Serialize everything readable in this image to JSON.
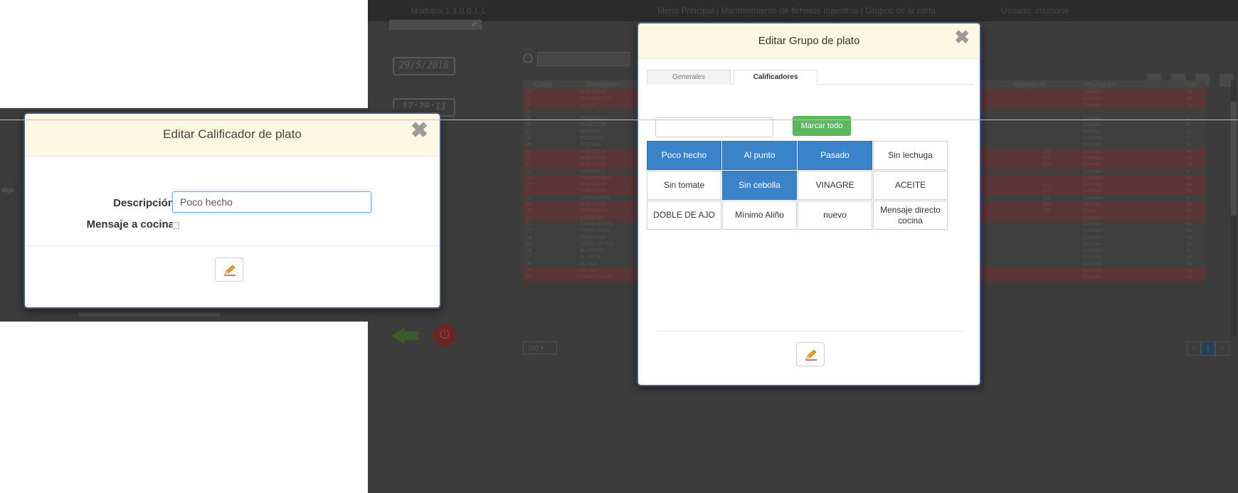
{
  "app": {
    "modulos": "Módulos 1.1.0.0.1.1",
    "menu_path": "Menú Principal  |  Mantenimiento de ficheros maestros  |  Grupos de la carta",
    "usuario": "Usuario: classone",
    "date": "29/5/2016",
    "time": "17:29:11",
    "grid_headers": {
      "codigo": "Código",
      "descripcion": "Descripción",
      "tipo_ingreso": "Tipo Ingreso",
      "macrogrupo": "Macrogrupo",
      "foto": "Foto"
    },
    "rows": [
      {
        "code": "01",
        "desc": "NUEVO189",
        "tipo": "",
        "macro": "Comidas",
        "foto": "No",
        "style": "red"
      },
      {
        "code": "02",
        "desc": "ALQUILERES",
        "tipo": "",
        "macro": "Comidas",
        "foto": "No",
        "style": "red"
      },
      {
        "code": "03",
        "desc": "VINOS",
        "tipo": "",
        "macro": "Comidas",
        "foto": "No",
        "style": "red"
      },
      {
        "code": "04",
        "desc": "",
        "tipo": "",
        "macro": "",
        "foto": "",
        "style": "dark"
      },
      {
        "code": "05",
        "desc": "PESCADOS",
        "tipo": "",
        "macro": "Comidas",
        "foto": "Sí",
        "style": "dark"
      },
      {
        "code": "06",
        "desc": "MARISCOS",
        "tipo": "",
        "macro": "Comidas",
        "foto": "Sí",
        "style": "dark"
      },
      {
        "code": "07",
        "desc": "BEBIDAS",
        "tipo": "",
        "macro": "Bebidas",
        "foto": "Sí",
        "style": "dark"
      },
      {
        "code": "08",
        "desc": "POSTRES",
        "tipo": "",
        "macro": "Comidas",
        "foto": "Sí",
        "style": "dark"
      },
      {
        "code": "09",
        "desc": "QUESOS",
        "tipo": "",
        "macro": "Comidas",
        "foto": "Sí",
        "style": "dark"
      },
      {
        "code": "10",
        "desc": "NUEVO219",
        "tipo": "123",
        "macro": "Comidas",
        "foto": "No",
        "style": "red"
      },
      {
        "code": "11",
        "desc": "NUEVO220",
        "tipo": "123",
        "macro": "Comidas",
        "foto": "No",
        "style": "red"
      },
      {
        "code": "12",
        "desc": "NUEVO222",
        "tipo": "123",
        "macro": "Comidas",
        "foto": "No",
        "style": "red"
      },
      {
        "code": "13",
        "desc": "ARROCES",
        "tipo": "",
        "macro": "Comidas",
        "foto": "Sí",
        "style": "dark"
      },
      {
        "code": "14",
        "desc": "TEMPORADA",
        "tipo": "",
        "macro": "Comidas",
        "foto": "No",
        "style": "red"
      },
      {
        "code": "16",
        "desc": "NUEVO214",
        "tipo": "123",
        "macro": "Comidas",
        "foto": "No",
        "style": "red"
      },
      {
        "code": "17",
        "desc": "NUEVO229",
        "tipo": "123",
        "macro": "Comidas",
        "foto": "No",
        "style": "red"
      },
      {
        "code": "18",
        "desc": "DESAYUNOS",
        "tipo": "123",
        "macro": "Comidas",
        "foto": "Sí",
        "style": "dark"
      },
      {
        "code": "19",
        "desc": "NUEVO192",
        "tipo": "123",
        "macro": "Comidas",
        "foto": "No",
        "style": "red"
      },
      {
        "code": "20",
        "desc": "ENTRADAS",
        "tipo": "123",
        "macro": "Otros",
        "foto": "No",
        "style": "red"
      },
      {
        "code": "21",
        "desc": "EXPRESS",
        "tipo": "",
        "macro": "Comidas",
        "foto": "Sí",
        "style": "red"
      },
      {
        "code": "22",
        "desc": "TINTO JOVEN",
        "tipo": "",
        "macro": "Comidas",
        "foto": "No",
        "style": "dark"
      },
      {
        "code": "23",
        "desc": "TINTO CRZA",
        "tipo": "",
        "macro": "Comidas",
        "foto": "No",
        "style": "dark"
      },
      {
        "code": "24",
        "desc": "TINTO RVA",
        "tipo": "",
        "macro": "Comidas",
        "foto": "No",
        "style": "dark"
      },
      {
        "code": "25",
        "desc": "TINTO GR RVA",
        "tipo": "",
        "macro": "Comidas",
        "foto": "No",
        "style": "dark"
      },
      {
        "code": "26",
        "desc": "BL JOVEN",
        "tipo": "",
        "macro": "Comidas",
        "foto": "Sí",
        "style": "dark"
      },
      {
        "code": "27",
        "desc": "BL CRZA",
        "tipo": "",
        "macro": "Comidas",
        "foto": "No",
        "style": "dark"
      },
      {
        "code": "28",
        "desc": "BL RVA",
        "tipo": "",
        "macro": "Comidas",
        "foto": "No",
        "style": "dark"
      },
      {
        "code": "29",
        "desc": "CAVAS",
        "tipo": "",
        "macro": "Comidas",
        "foto": "No",
        "style": "red"
      },
      {
        "code": "30",
        "desc": "CHAMPAGNE",
        "tipo": "",
        "macro": "Comidas",
        "foto": "No",
        "style": "red"
      }
    ],
    "page_size": "100 ▾",
    "pager": [
      "<",
      "1",
      ">"
    ]
  },
  "grupo_modal": {
    "title": "Editar Grupo de plato",
    "close_glyph": "✖",
    "tabs": [
      "Generales",
      "Calificadores"
    ],
    "active_tab": "Calificadores",
    "marcar_todo": "Marcar todo",
    "filter_value": "",
    "calificadores": [
      {
        "label": "Poco hecho",
        "selected": true
      },
      {
        "label": "Al punto",
        "selected": true
      },
      {
        "label": "Pasado",
        "selected": true
      },
      {
        "label": "Sin lechuga",
        "selected": false
      },
      {
        "label": "Sin tomate",
        "selected": false
      },
      {
        "label": "Sin cebolla",
        "selected": true
      },
      {
        "label": "VINAGRE",
        "selected": false
      },
      {
        "label": "ACEITE",
        "selected": false
      },
      {
        "label": "DOBLE DE AJO",
        "selected": false
      },
      {
        "label": "Mínimo Aliño",
        "selected": false
      },
      {
        "label": "nuevo",
        "selected": false
      },
      {
        "label": "Mensaje directo cocina",
        "selected": false
      }
    ],
    "selected_color": "#3b83c9"
  },
  "calif_modal": {
    "title": "Editar Calificador de plato",
    "close_glyph": "✖",
    "descripcion_label": "Descripción",
    "descripcion_value": "Poco hecho",
    "mensaje_label": "Mensaje a cocina",
    "mensaje_checked": false,
    "backdrop_text": "digo"
  },
  "colors": {
    "header_bg": "#fcf8e3",
    "success": "#5cb85c",
    "primary": "#3b83c9",
    "row_red": "#5a3636"
  },
  "icons": [
    "search-icon",
    "close-icon",
    "pencil-icon",
    "back-arrow-icon",
    "power-icon",
    "check-icon"
  ]
}
